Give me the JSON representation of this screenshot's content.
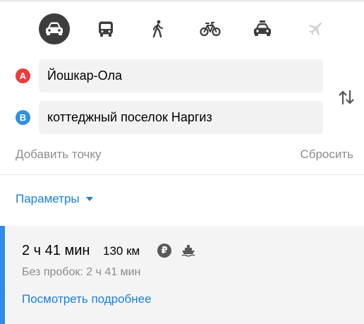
{
  "transport_modes": [
    {
      "name": "car",
      "active": true
    },
    {
      "name": "bus",
      "active": false
    },
    {
      "name": "pedestrian",
      "active": false
    },
    {
      "name": "bicycle",
      "active": false
    },
    {
      "name": "taxi",
      "active": false
    },
    {
      "name": "plane",
      "active": false
    }
  ],
  "route_points": {
    "a_badge": "A",
    "a_value": "Йошкар-Ола",
    "b_badge": "B",
    "b_value": "коттеджный поселок Наргиз"
  },
  "actions": {
    "add_point": "Добавить точку",
    "reset": "Сбросить"
  },
  "parameters": {
    "label": "Параметры"
  },
  "route": {
    "time": "2 ч 41 мин",
    "distance": "130 км",
    "toll_symbol": "₽",
    "no_traffic": "Без пробок: 2 ч 41 мин",
    "details_link": "Посмотреть подробнее"
  },
  "colors": {
    "accent_blue": "#1a7fe0",
    "point_a": "#ef3a3a",
    "point_b": "#2f8fe0",
    "active_mode": "#3d3d3d"
  }
}
